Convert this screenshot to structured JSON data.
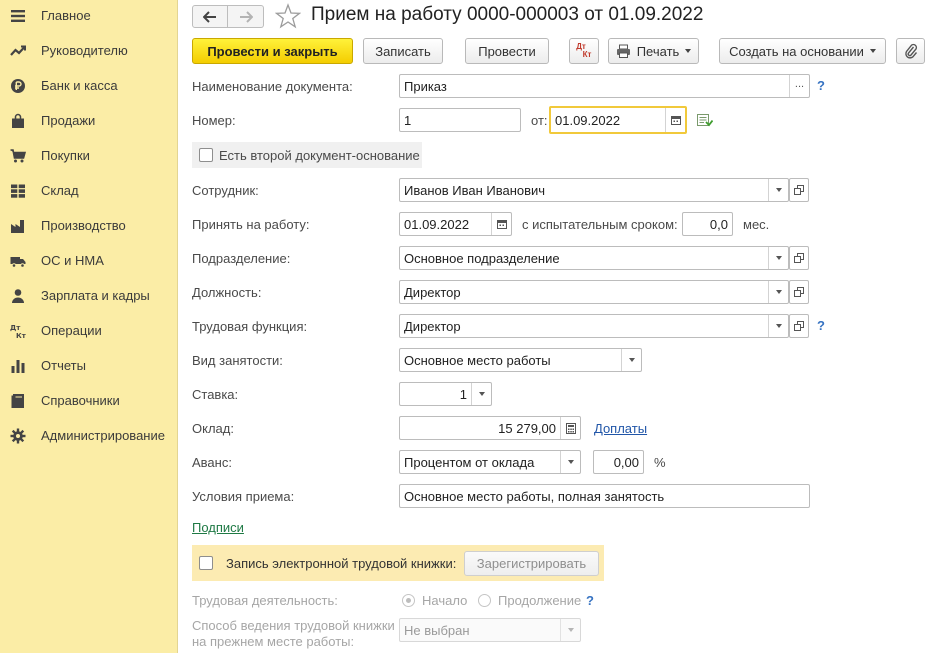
{
  "sidebar": {
    "items": [
      {
        "label": "Главное",
        "icon": "menu-lines-icon"
      },
      {
        "label": "Руководителю",
        "icon": "trend-chart-icon"
      },
      {
        "label": "Банк и касса",
        "icon": "ruble-coin-icon"
      },
      {
        "label": "Продажи",
        "icon": "shopping-bag-icon"
      },
      {
        "label": "Покупки",
        "icon": "shopping-cart-icon"
      },
      {
        "label": "Склад",
        "icon": "warehouse-grid-icon"
      },
      {
        "label": "Производство",
        "icon": "factory-icon"
      },
      {
        "label": "ОС и НМА",
        "icon": "truck-icon"
      },
      {
        "label": "Зарплата и кадры",
        "icon": "person-icon"
      },
      {
        "label": "Операции",
        "icon": "dt-kt-icon"
      },
      {
        "label": "Отчеты",
        "icon": "bar-chart-icon"
      },
      {
        "label": "Справочники",
        "icon": "books-icon"
      },
      {
        "label": "Администрирование",
        "icon": "gear-icon"
      }
    ]
  },
  "header": {
    "title": "Прием на работу 0000-000003 от 01.09.2022"
  },
  "toolbar": {
    "post_close": "Провести и закрыть",
    "save": "Записать",
    "post": "Провести",
    "print": "Печать",
    "create_based": "Создать на основании",
    "dtkt_top": "Дт",
    "dtkt_bottom": "Кт"
  },
  "form": {
    "doc_name_label": "Наименование документа:",
    "doc_name_value": "Приказ",
    "doc_name_more": "...",
    "number_label": "Номер:",
    "number_value": "1",
    "date_from_label": "от:",
    "date_value": "01.09.2022",
    "second_basis_label": "Есть второй документ-основание",
    "employee_label": "Сотрудник:",
    "employee_value": "Иванов Иван Иванович",
    "hire_date_label": "Принять на работу:",
    "hire_date_value": "01.09.2022",
    "probation_label": "с испытательным сроком:",
    "probation_value": "0,0",
    "probation_unit": "мес.",
    "department_label": "Подразделение:",
    "department_value": "Основное подразделение",
    "position_label": "Должность:",
    "position_value": "Директор",
    "labor_function_label": "Трудовая функция:",
    "labor_function_value": "Директор",
    "employment_type_label": "Вид занятости:",
    "employment_type_value": "Основное место работы",
    "rate_label": "Ставка:",
    "rate_value": "1",
    "salary_label": "Оклад:",
    "salary_value": "15 279,00",
    "extra_pay_link": "Доплаты",
    "advance_label": "Аванс:",
    "advance_method": "Процентом от оклада",
    "advance_value": "0,00",
    "advance_unit": "%",
    "conditions_label": "Условия приема:",
    "conditions_value": "Основное место работы, полная занятость",
    "signatures_link": "Подписи",
    "help": "?"
  },
  "etk": {
    "label": "Запись электронной трудовой книжки:",
    "register_button": "Зарегистрировать",
    "activity_label": "Трудовая деятельность:",
    "opt_start": "Начало",
    "opt_continue": "Продолжение",
    "method_label_1": "Способ ведения трудовой книжки",
    "method_label_2": "на прежнем месте работы:",
    "method_value": "Не выбран"
  }
}
